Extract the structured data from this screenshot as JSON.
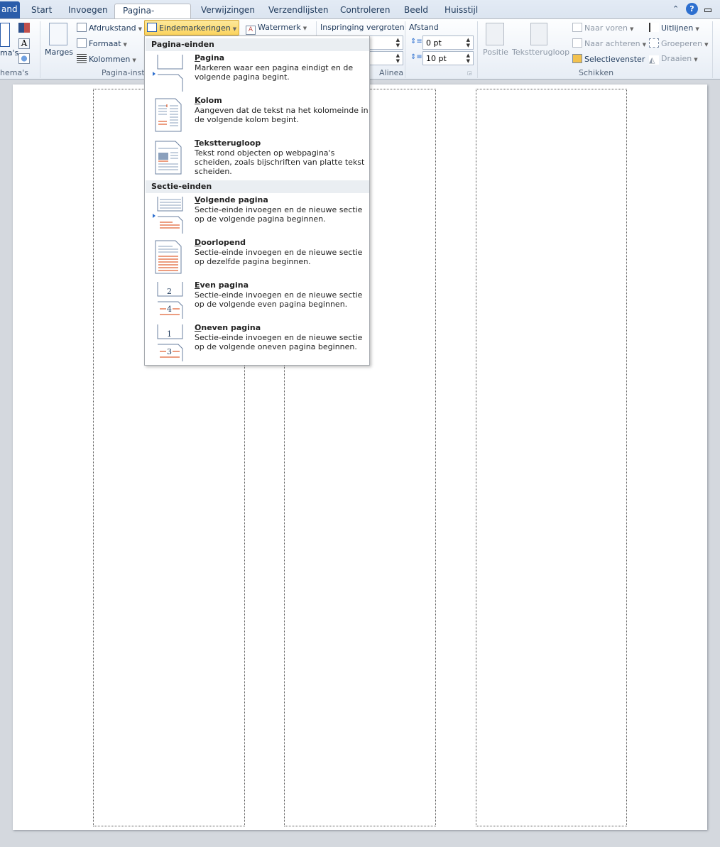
{
  "tabs": {
    "file": "and",
    "items": [
      "Start",
      "Invoegen",
      "Pagina-indeling",
      "Verwijzingen",
      "Verzendlijsten",
      "Controleren",
      "Beeld",
      "Huisstijl"
    ],
    "active": "Pagina-indeling"
  },
  "ribbon": {
    "themes": {
      "label": "ma's",
      "group": "hema's"
    },
    "page_setup": {
      "margins": "Marges",
      "orientation": "Afdrukstand",
      "size": "Formaat",
      "columns": "Kolommen",
      "breaks": "Eindemarkeringen",
      "watermark": "Watermerk",
      "group": "Pagina-inste"
    },
    "paragraph": {
      "indent": "Inspringing vergroten",
      "spacing": "Afstand",
      "before": "0 pt",
      "after": "10 pt",
      "group": "Alinea"
    },
    "arrange": {
      "position": "Positie",
      "wrap": "Tekstterugloop",
      "forward": "Naar voren",
      "backward": "Naar achteren",
      "selection": "Selectievenster",
      "align": "Uitlijnen",
      "group_btn": "Groeperen",
      "rotate": "Draaien",
      "group": "Schikken"
    }
  },
  "menu": {
    "sections": [
      {
        "header": "Pagina-einden",
        "items": [
          {
            "title": "Pagina",
            "desc": "Markeren waar een pagina eindigt en de volgende pagina begint.",
            "icon": "page-break-icon"
          },
          {
            "title": "Kolom",
            "desc": "Aangeven dat de tekst na het kolomeinde in de volgende kolom begint.",
            "icon": "column-break-icon"
          },
          {
            "title": "Tekstterugloop",
            "desc": "Tekst rond objecten op webpagina's scheiden, zoals bijschriften van platte tekst scheiden.",
            "icon": "text-wrap-break-icon"
          }
        ]
      },
      {
        "header": "Sectie-einden",
        "items": [
          {
            "title": "Volgende pagina",
            "desc": "Sectie-einde invoegen en de nieuwe sectie op de volgende pagina beginnen.",
            "icon": "next-page-icon"
          },
          {
            "title": "Doorlopend",
            "desc": "Sectie-einde invoegen en de nieuwe sectie op dezelfde pagina beginnen.",
            "icon": "continuous-icon"
          },
          {
            "title": "Even pagina",
            "desc": "Sectie-einde invoegen en de nieuwe sectie op de volgende even pagina beginnen.",
            "icon": "even-page-icon"
          },
          {
            "title": "Oneven pagina",
            "desc": "Sectie-einde invoegen en de nieuwe sectie op de volgende oneven pagina beginnen.",
            "icon": "odd-page-icon"
          }
        ]
      }
    ]
  },
  "colors": {
    "accent": "#2a5caa",
    "highlight": "#fbdc6d",
    "break_line": "#d83b01"
  }
}
